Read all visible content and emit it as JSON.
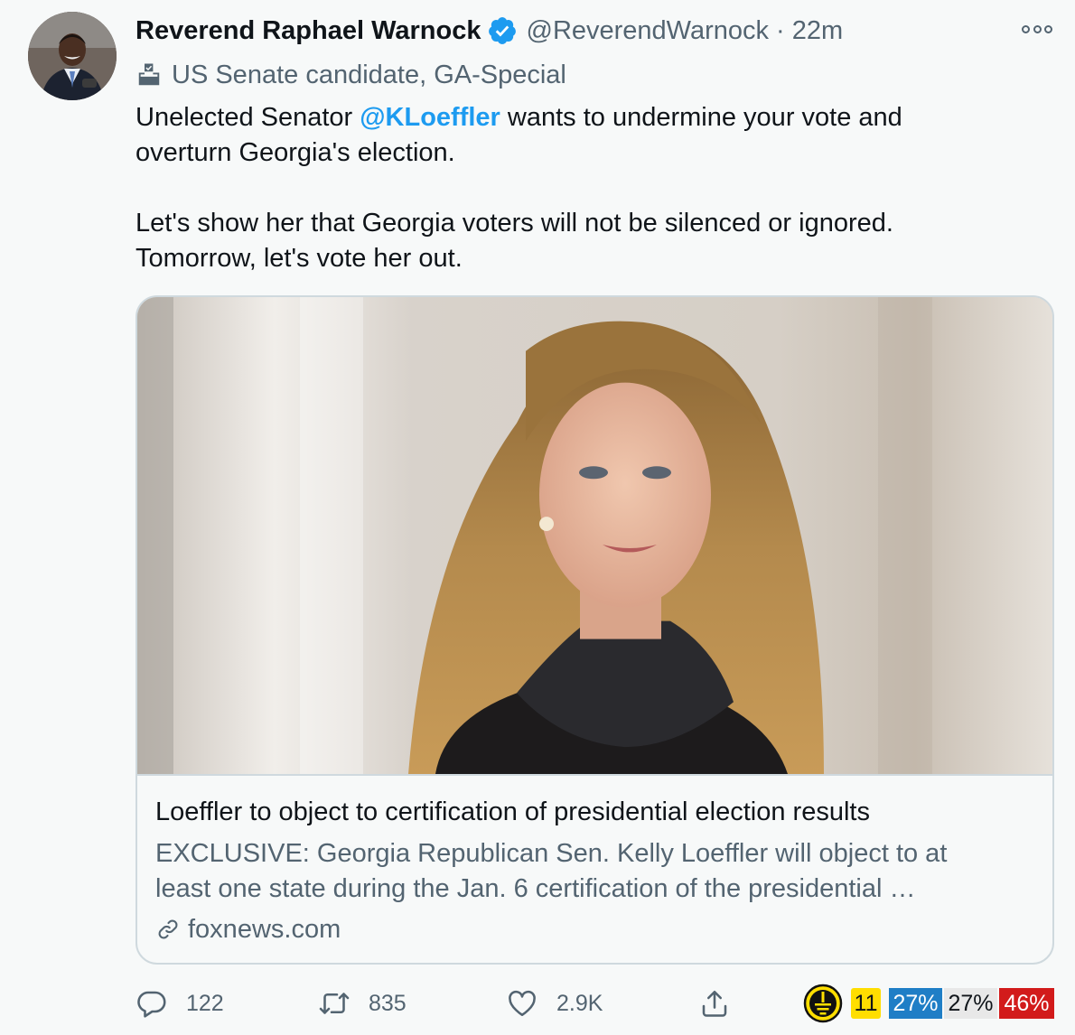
{
  "author": {
    "display_name": "Reverend Raphael Warnock",
    "handle": "@ReverendWarnock",
    "separator": "·",
    "time": "22m",
    "verified": true,
    "label": "US Senate candidate, GA-Special",
    "label_icon": "ballot-box-icon"
  },
  "tweet": {
    "line1_pre": "Unelected Senator ",
    "mention": "@KLoeffler",
    "line1_post": " wants to undermine your vote and",
    "line2": "overturn Georgia's election.",
    "line3": "Let's show her that Georgia voters will not be silenced or ignored.",
    "line4": "Tomorrow, let's vote her out."
  },
  "card": {
    "title": "Loeffler to object to certification of presidential election results",
    "desc_line1": "EXCLUSIVE: Georgia Republican Sen. Kelly Loeffler will object to at",
    "desc_line2": "least one state during the Jan. 6 certification of the presidential …",
    "domain": "foxnews.com"
  },
  "actions": {
    "replies": "122",
    "retweets": "835",
    "likes": "2.9K"
  },
  "bias_rating": {
    "count": "11",
    "left_pct": "27%",
    "center_pct": "27%",
    "right_pct": "46%"
  },
  "colors": {
    "accent": "#1d9bf0",
    "muted_text": "#536471",
    "card_border": "#cfd9de",
    "badge_yellow": "#ffde00",
    "left_blue": "#1f7ec6",
    "right_red": "#d21b1b"
  }
}
